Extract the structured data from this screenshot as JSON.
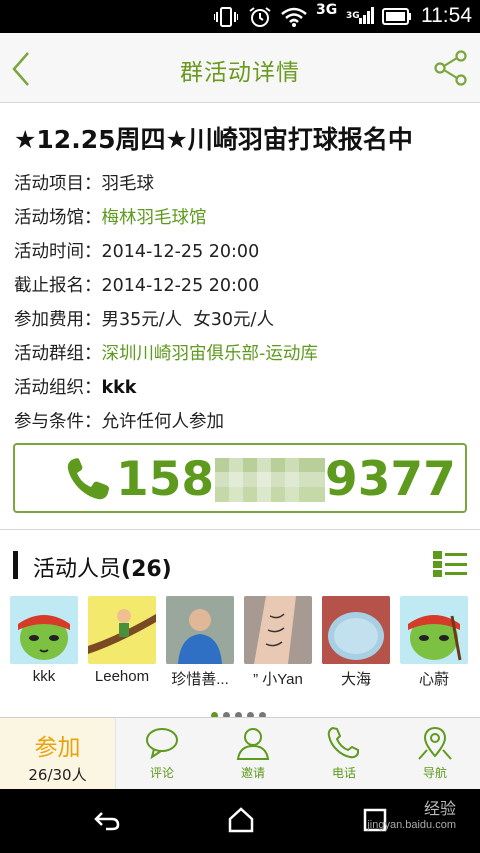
{
  "status_bar": {
    "time": "11:54",
    "network": "3G",
    "network_small": "3G"
  },
  "header": {
    "title": "群活动详情"
  },
  "event": {
    "title": "★12.25周四★川崎羽宙打球报名中",
    "rows": [
      {
        "key": "活动项目：",
        "value": "羽毛球"
      },
      {
        "key": "活动场馆：",
        "value": "梅林羽毛球馆"
      },
      {
        "key": "活动时间：",
        "value": "2014-12-25 20:00"
      },
      {
        "key": "截止报名：",
        "value": "2014-12-25 20:00"
      },
      {
        "key": "参加费用：",
        "value": "男35元/人  女30元/人"
      },
      {
        "key": "活动群组：",
        "value": "深圳川崎羽宙俱乐部-运动库"
      },
      {
        "key": "活动组织：",
        "value": "kkk"
      },
      {
        "key": "参与条件：",
        "value": "允许任何人参加"
      }
    ],
    "phone_prefix": "158",
    "phone_suffix": "9377"
  },
  "members": {
    "label": "活动人员",
    "count": "(26)",
    "list": [
      {
        "name": "kkk"
      },
      {
        "name": "Leehom"
      },
      {
        "name": "珍惜善..."
      },
      {
        "name": "” 小Yan"
      },
      {
        "name": "大海"
      },
      {
        "name": "心蔚"
      }
    ]
  },
  "actions": {
    "join_label": "参加",
    "join_count": "26/30人",
    "comment": "评论",
    "invite": "邀请",
    "call": "电话",
    "navigate": "导航"
  },
  "watermark": {
    "line1": "经验",
    "line2": "jingyan.baidu.com"
  },
  "colors": {
    "accent": "#5e9a1e",
    "join": "#e8a30c"
  },
  "icons": [
    "back-icon",
    "share-icon",
    "phone-icon",
    "list-toggle-icon",
    "comment-icon",
    "invite-icon",
    "call-icon",
    "navigate-icon"
  ]
}
